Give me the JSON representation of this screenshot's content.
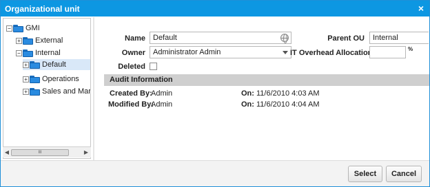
{
  "window": {
    "title": "Organizational unit",
    "close_glyph": "×"
  },
  "tree": {
    "nodes": [
      {
        "label": "GMI",
        "toggle": "−",
        "expanded": true
      },
      {
        "label": "External",
        "toggle": "+"
      },
      {
        "label": "Internal",
        "toggle": "−",
        "expanded": true
      },
      {
        "label": "Default",
        "toggle": "+",
        "selected": true
      },
      {
        "label": "Operations",
        "toggle": "+"
      },
      {
        "label": "Sales and Marketing",
        "toggle": "+"
      }
    ],
    "scrollbar": {
      "left_arrow": "◀",
      "right_arrow": "▶",
      "thumb_grip": "III"
    }
  },
  "form": {
    "name_label": "Name",
    "name_value": "Default",
    "owner_label": "Owner",
    "owner_value": "Administrator Admin",
    "deleted_label": "Deleted",
    "deleted_checked": false,
    "parent_ou_label": "Parent OU",
    "parent_ou_value": "Internal",
    "it_overhead_label": "IT Overhead Allocation",
    "it_overhead_value": "",
    "it_overhead_unit": "%"
  },
  "audit": {
    "header": "Audit Information",
    "created_by_label": "Created By:",
    "created_by_value": "Admin",
    "created_on_label": "On:",
    "created_on_value": "11/6/2010 4:03 AM",
    "modified_by_label": "Modified By:",
    "modified_by_value": "Admin",
    "modified_on_label": "On:",
    "modified_on_value": "11/6/2010 4:04 AM"
  },
  "buttons": {
    "select": "Select",
    "cancel": "Cancel"
  },
  "colors": {
    "titlebar": "#0d97e2",
    "selection": "#d9e8f8",
    "folder": "#2a8be0"
  },
  "icons": {
    "folder": "folder-icon",
    "globe": "globe-icon",
    "dropdown": "chevron-down-icon",
    "close": "close-icon"
  }
}
